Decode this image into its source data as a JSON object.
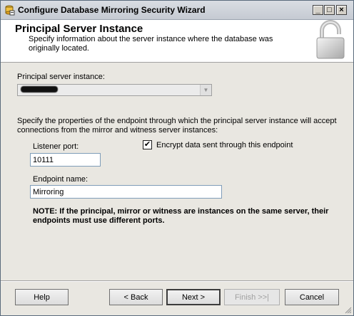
{
  "window": {
    "title": "Configure Database Mirroring Security Wizard",
    "controls": [
      "_",
      "□",
      "×"
    ]
  },
  "header": {
    "title": "Principal Server Instance",
    "subtitle": "Specify information about the server instance where the database was originally located."
  },
  "form": {
    "principal_label": "Principal server instance:",
    "principal_value": "",
    "endpoint_desc": "Specify the properties of the endpoint through which the principal server instance will accept connections from the mirror and witness server instances:",
    "listener_port_label": "Listener port:",
    "listener_port_value": "10111",
    "encrypt_checked": true,
    "encrypt_label": "Encrypt data sent through this endpoint",
    "endpoint_name_label": "Endpoint name:",
    "endpoint_name_value": "Mirroring",
    "note": "NOTE: If the principal, mirror or witness are instances on the same server, their endpoints must use different ports."
  },
  "buttons": {
    "help": "Help",
    "back": "< Back",
    "next": "Next >",
    "finish": "Finish >>|",
    "cancel": "Cancel"
  }
}
